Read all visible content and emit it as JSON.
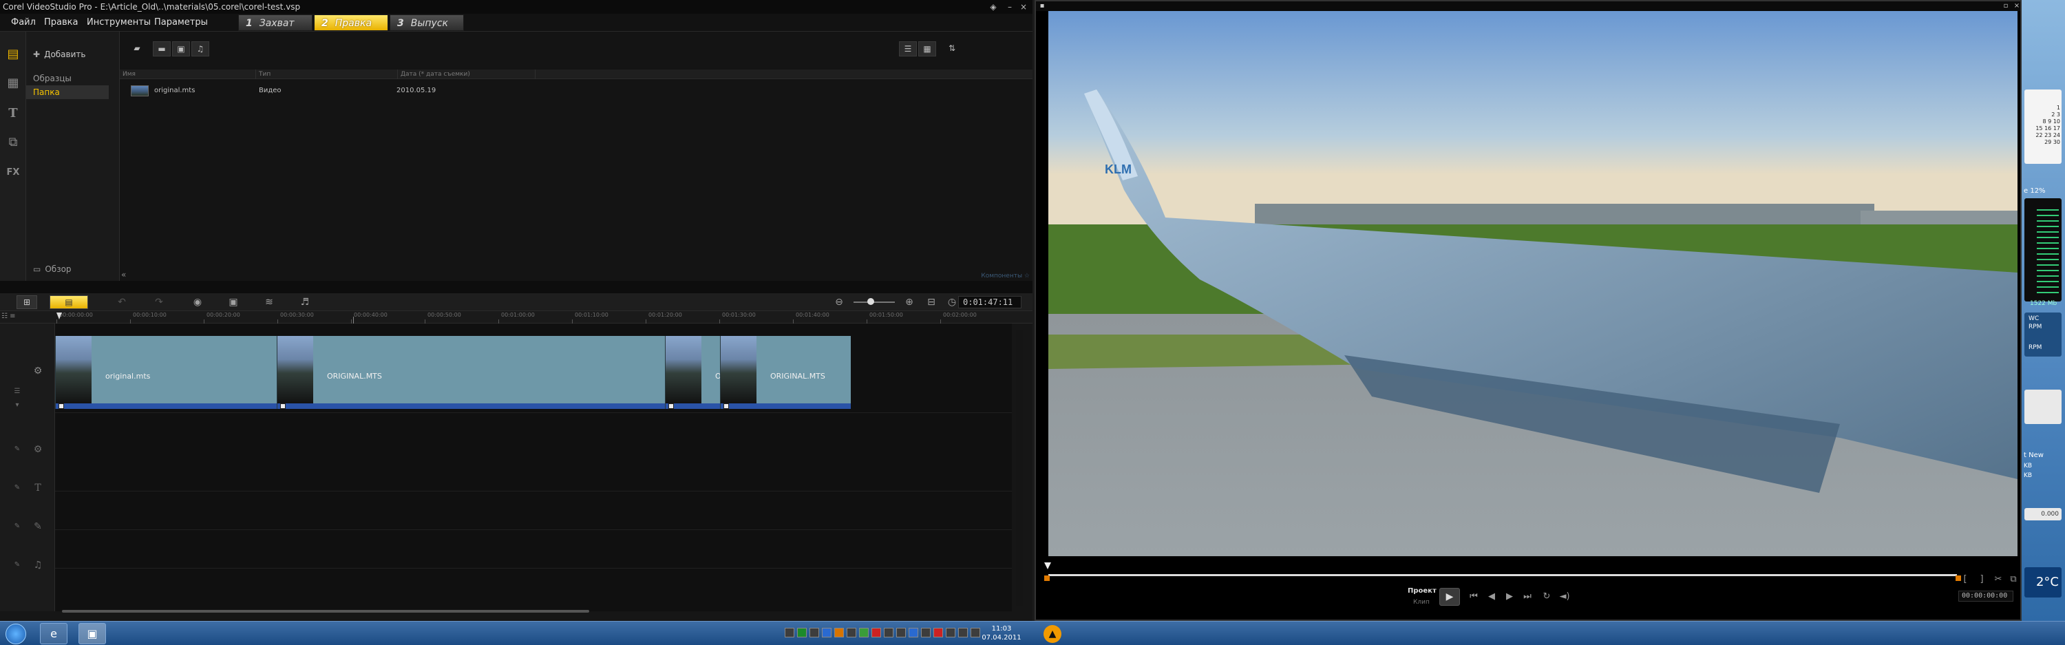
{
  "app": {
    "title": "Corel VideoStudio Pro - E:\\Article_Old\\..\\materials\\05.corel\\corel-test.vsp",
    "menu": [
      "Файл",
      "Правка",
      "Инструменты",
      "Параметры"
    ],
    "steps": [
      {
        "num": "1",
        "label": "Захват",
        "active": false
      },
      {
        "num": "2",
        "label": "Правка",
        "active": true
      },
      {
        "num": "3",
        "label": "Выпуск",
        "active": false
      }
    ]
  },
  "library": {
    "add_label": "Добавить",
    "folders": [
      {
        "label": "Образцы",
        "selected": false
      },
      {
        "label": "Папка",
        "selected": true
      }
    ],
    "browse_label": "Обзор",
    "columns": [
      "Имя",
      "Тип",
      "Дата (* дата съемки)"
    ],
    "files": [
      {
        "name": "original.mts",
        "type": "Видео",
        "date": "2010.05.19"
      }
    ],
    "footer": "Компоненты ☆"
  },
  "timeline": {
    "timecode": "0:01:47:11",
    "ruler": [
      "00:00:00:00",
      "00:00:10:00",
      "00:00:20:00",
      "00:00:30:00",
      "00:00:40:00",
      "00:00:50:00",
      "00:01:00:00",
      "00:01:10:00",
      "00:01:20:00",
      "00:01:30:00",
      "00:01:40:00",
      "00:01:50:00",
      "00:02:00:00"
    ],
    "clips": [
      {
        "label": "original.mts"
      },
      {
        "label": "ORIGINAL.MTS"
      },
      {
        "label": "O"
      },
      {
        "label": "ORIGINAL.MTS"
      }
    ]
  },
  "preview": {
    "project_label": "Проект",
    "clip_label": "Клип",
    "timecode": "00:00:00:00",
    "logo_text": "KLM"
  },
  "taskbar": {
    "time": "11:03",
    "date": "07.04.2011"
  },
  "desktop": {
    "calendar": [
      "1",
      "2",
      "3",
      "8",
      "9",
      "10",
      "15",
      "16",
      "17",
      "22",
      "23",
      "24",
      "29",
      "30"
    ],
    "cpu_label": "е 12%",
    "mem_label": "1522 Mb",
    "rpm_label": "RPM",
    "net_label": "t New",
    "net_value": "0.000",
    "temp": "2°C",
    "codes": [
      "WC",
      "RPM",
      "KB",
      "KB"
    ]
  },
  "colors": {
    "accent": "#f6c400",
    "clip_fill": "#6e98a8",
    "clip_bar": "#2a53a7",
    "taskbar": "#2a5a92"
  }
}
